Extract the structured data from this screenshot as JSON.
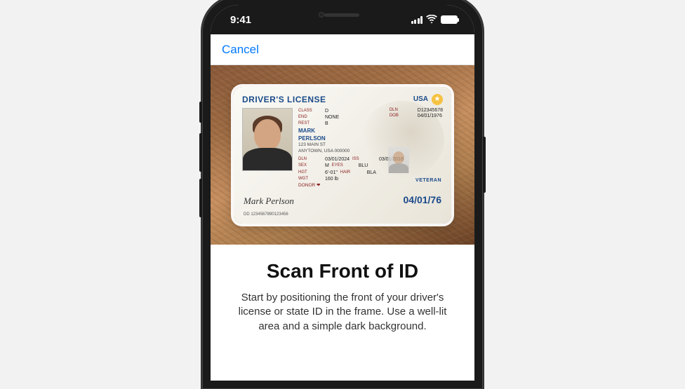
{
  "status": {
    "time": "9:41"
  },
  "nav": {
    "cancel": "Cancel"
  },
  "license": {
    "title": "DRIVER'S LICENSE",
    "country": "USA",
    "class_label": "CLASS",
    "class_val": "D",
    "end_label": "END",
    "end_val": "NONE",
    "rest_label": "REST",
    "rest_val": "B",
    "dln_label": "DLN",
    "dln_val": "D12345678",
    "dob_label": "DOB",
    "dob_val": "04/01/1976",
    "first": "MARK",
    "last": "PERLSON",
    "addr1": "123 MAIN ST",
    "addr2": "ANYTOWN, USA 000000",
    "exp_label": "DLN",
    "exp_val": "03/01/2024",
    "iss_label": "ISS",
    "iss_val": "03/01/2016",
    "sex_label": "SEX",
    "sex_val": "M",
    "eyes_label": "EYES",
    "eyes_val": "BLU",
    "hgt_label": "HGT",
    "hgt_val": "6'-01\"",
    "hair_label": "HAIR",
    "hair_val": "BLA",
    "wgt_label": "WGT",
    "wgt_val": "160 lb",
    "donor": "DONOR ❤",
    "veteran": "VETERAN",
    "big_date": "04/01/76",
    "signature": "Mark Perlson",
    "dd_label": "DD",
    "dd_val": "1234567890123456"
  },
  "instructions": {
    "title": "Scan Front of ID",
    "body": "Start by positioning the front of your driver's license or state ID in the frame. Use a well-lit area and a simple dark background."
  }
}
